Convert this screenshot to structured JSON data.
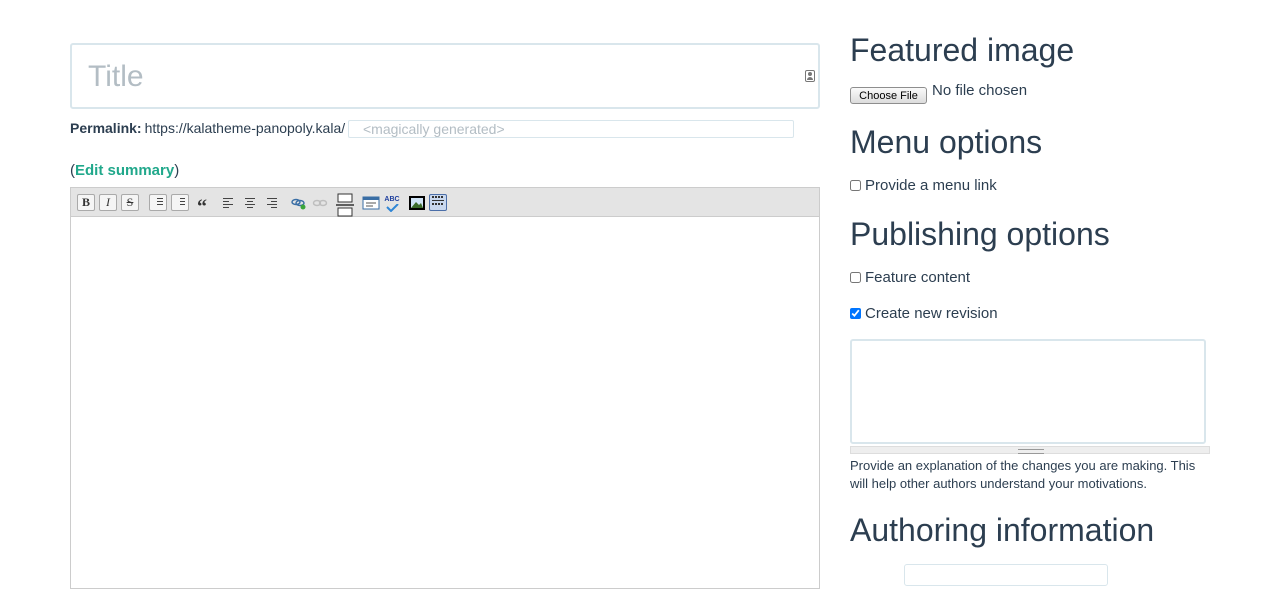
{
  "title_field": {
    "placeholder": "Title",
    "value": ""
  },
  "permalink": {
    "label": "Permalink:",
    "base_url": "https://kalatheme-panopoly.kala/",
    "placeholder": "<magically generated>"
  },
  "summary": {
    "open_paren": "(",
    "link_label": "Edit summary",
    "close_paren": ")"
  },
  "editor_toolbar": {
    "buttons": [
      {
        "name": "bold",
        "label": "B"
      },
      {
        "name": "italic",
        "label": "I"
      },
      {
        "name": "strikethrough",
        "label": "S"
      },
      {
        "name": "bullet-list",
        "label": ""
      },
      {
        "name": "numbered-list",
        "label": ""
      },
      {
        "name": "blockquote",
        "label": "“"
      },
      {
        "name": "align-left",
        "label": ""
      },
      {
        "name": "align-center",
        "label": ""
      },
      {
        "name": "align-right",
        "label": ""
      },
      {
        "name": "insert-link",
        "label": ""
      },
      {
        "name": "unlink",
        "label": ""
      },
      {
        "name": "read-more",
        "label": ""
      },
      {
        "name": "paste-word",
        "label": ""
      },
      {
        "name": "spellcheck",
        "label": "ABC"
      },
      {
        "name": "insert-media",
        "label": ""
      },
      {
        "name": "toggle-toolbar",
        "label": ""
      }
    ]
  },
  "featured_image": {
    "heading": "Featured image",
    "choose_button": "Choose File",
    "file_status": "No file chosen"
  },
  "menu_options": {
    "heading": "Menu options",
    "provide_menu_link": {
      "label": "Provide a menu link",
      "checked": false
    }
  },
  "publishing_options": {
    "heading": "Publishing options",
    "feature_content": {
      "label": "Feature content",
      "checked": false
    },
    "create_revision": {
      "label": "Create new revision",
      "checked": true
    },
    "revision_log": {
      "value": ""
    },
    "revision_help": "Provide an explanation of the changes you are making. This will help other authors understand your motivations."
  },
  "authoring_information": {
    "heading": "Authoring information"
  },
  "colors": {
    "text": "#2c3e50",
    "link": "#21a88b",
    "field_border": "#d9e6ec",
    "placeholder": "#b3bdc4"
  }
}
